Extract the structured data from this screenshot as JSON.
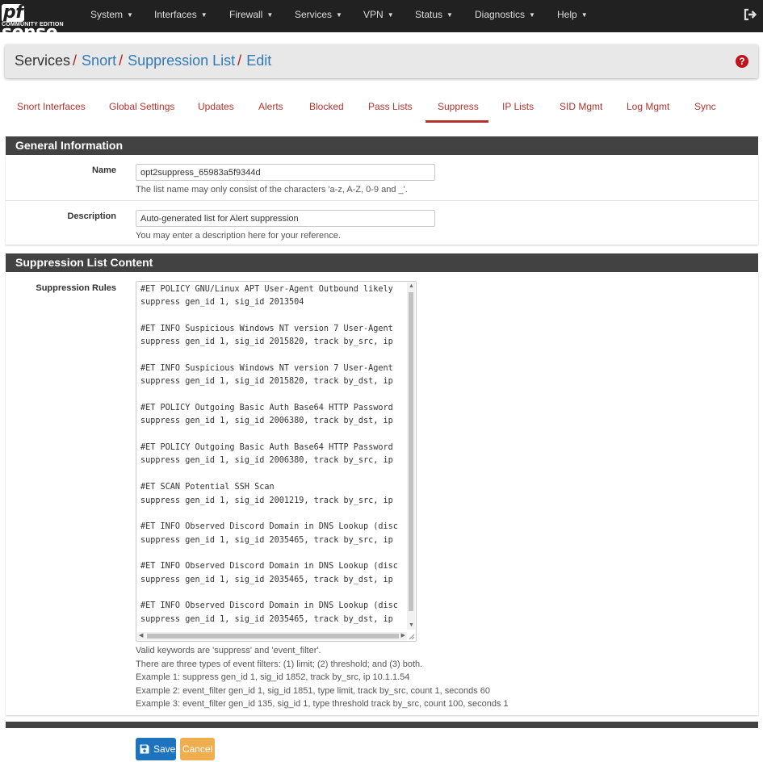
{
  "navbar": {
    "brand": "sense",
    "brand_prefix": "pf",
    "edition": "COMMUNITY EDITION",
    "menu": [
      {
        "label": "System",
        "x": 0
      },
      {
        "label": "Interfaces"
      },
      {
        "label": "Firewall"
      },
      {
        "label": "Services"
      },
      {
        "label": "VPN"
      },
      {
        "label": "Status"
      },
      {
        "label": "Diagnostics"
      },
      {
        "label": "Help"
      }
    ],
    "logout_icon": "sign-out-icon"
  },
  "breadcrumb": {
    "items": [
      "Services",
      "Snort",
      "Suppression List",
      "Edit"
    ],
    "separator": "/",
    "help_icon": "question-circle-icon",
    "help_glyph": "?"
  },
  "tabs": {
    "items": [
      "Snort Interfaces",
      "Global Settings",
      "Updates",
      "Alerts",
      "Blocked",
      "Pass Lists",
      "Suppress",
      "IP Lists",
      "SID Mgmt",
      "Log Mgmt",
      "Sync"
    ],
    "active": "Suppress"
  },
  "general": {
    "title": "General Information",
    "name_label": "Name",
    "name_value": "opt2suppress_65983a5f9344d",
    "name_help": "The list name may only consist of the characters 'a-z, A-Z, 0-9 and _'.",
    "desc_label": "Description",
    "desc_value": "Auto-generated list for Alert suppression",
    "desc_help": "You may enter a description here for your reference."
  },
  "content": {
    "title": "Suppression List Content",
    "rules_label": "Suppression Rules",
    "rules_lines": [
      "#ET POLICY GNU/Linux APT User-Agent Outbound likely",
      "suppress gen_id 1, sig_id 2013504",
      "",
      "#ET INFO Suspicious Windows NT version 7 User-Agent",
      "suppress gen_id 1, sig_id 2015820, track by_src, ip",
      "",
      "#ET INFO Suspicious Windows NT version 7 User-Agent",
      "suppress gen_id 1, sig_id 2015820, track by_dst, ip",
      "",
      "#ET POLICY Outgoing Basic Auth Base64 HTTP Password",
      "suppress gen_id 1, sig_id 2006380, track by_dst, ip",
      "",
      "#ET POLICY Outgoing Basic Auth Base64 HTTP Password",
      "suppress gen_id 1, sig_id 2006380, track by_src, ip",
      "",
      "#ET SCAN Potential SSH Scan",
      "suppress gen_id 1, sig_id 2001219, track by_src, ip",
      "",
      "#ET INFO Observed Discord Domain in DNS Lookup (disc",
      "suppress gen_id 1, sig_id 2035465, track by_src, ip",
      "",
      "#ET INFO Observed Discord Domain in DNS Lookup (disc",
      "suppress gen_id 1, sig_id 2035465, track by_dst, ip",
      "",
      "#ET INFO Observed Discord Domain in DNS Lookup (disc",
      "suppress gen_id 1, sig_id 2035465, track by_dst, ip"
    ],
    "info_lines": [
      "Valid keywords are 'suppress' and 'event_filter'.",
      "There are three types of event filters: (1) limit; (2) threshold; and (3) both.",
      "Example 1: suppress gen_id 1, sig_id 1852, track by_src, ip 10.1.1.54",
      "Example 2: event_filter gen_id 1, sig_id 1851, type limit, track by_src, count 1, seconds 60",
      "Example 3: event_filter gen_id 135, sig_id 1, type threshold track by_src, count 100, seconds 1"
    ]
  },
  "buttons": {
    "save": "Save",
    "save_icon": "floppy-disk-icon",
    "cancel": "Cancel"
  },
  "colors": {
    "navbar": "#212121",
    "accent": "#b3332d",
    "link": "#337ab7",
    "panel_head": "#424242",
    "save": "#1e73be",
    "cancel": "#f0ad4e"
  }
}
